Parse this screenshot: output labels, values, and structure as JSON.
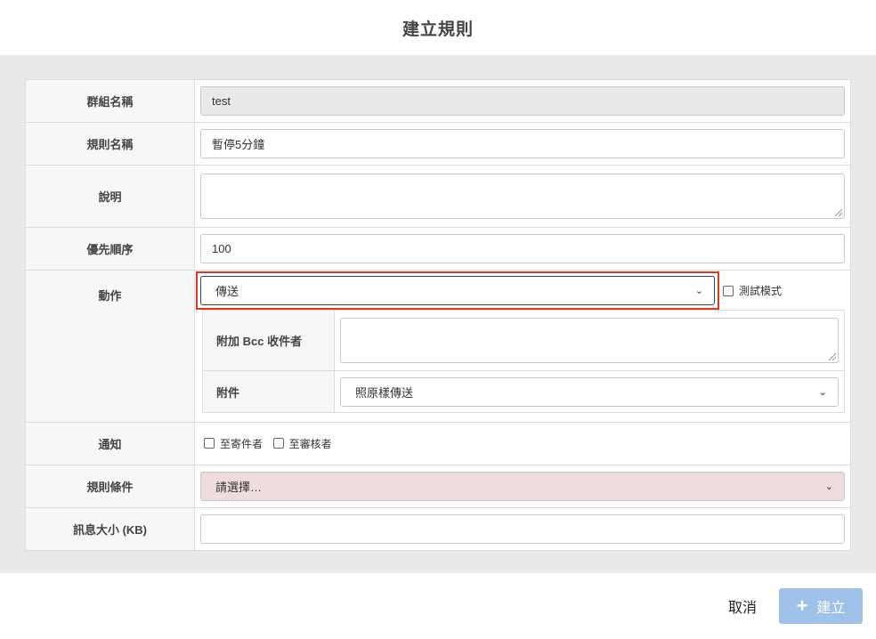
{
  "dialog": {
    "title": "建立規則"
  },
  "form": {
    "group_name": {
      "label": "群組名稱",
      "value": "test"
    },
    "rule_name": {
      "label": "規則名稱",
      "value": "暫停5分鐘"
    },
    "description": {
      "label": "說明",
      "value": ""
    },
    "priority": {
      "label": "優先順序",
      "value": "100"
    },
    "action": {
      "label": "動作",
      "selected": "傳送",
      "test_mode_label": "測試模式",
      "bcc": {
        "label": "附加 Bcc 收件者",
        "value": ""
      },
      "attachment": {
        "label": "附件",
        "selected": "照原樣傳送"
      }
    },
    "notify": {
      "label": "通知",
      "to_sender": "至寄件者",
      "to_reviewer": "至審核者"
    },
    "conditions": {
      "label": "規則條件",
      "selected": "請選擇…"
    },
    "message_size": {
      "label": "訊息大小 (KB)",
      "value": ""
    }
  },
  "footer": {
    "cancel_label": "取消",
    "create_label": "建立"
  },
  "colors": {
    "highlight": "#e8341d",
    "create_button": "#9ec2ea",
    "conditions_bg": "#efdddd"
  }
}
